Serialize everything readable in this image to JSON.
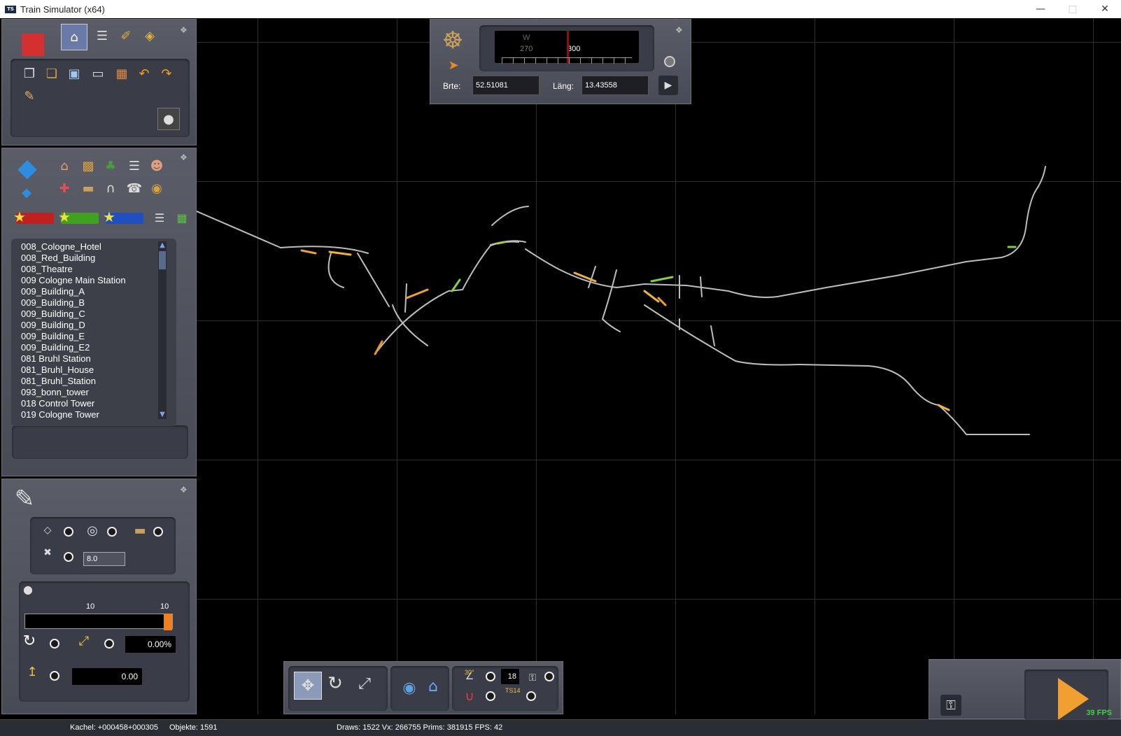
{
  "window": {
    "title": "Train Simulator (x64)",
    "badge": "TS"
  },
  "compass": {
    "dir_letter": "W",
    "tick_left": "270",
    "tick_center": "300",
    "lat_label": "Brte:",
    "lat_value": "52.51081",
    "lon_label": "Läng:",
    "lon_value": "13.43558"
  },
  "objects": {
    "items": [
      "008_Cologne_Hotel",
      "008_Red_Building",
      "008_Theatre",
      "009 Cologne Main Station",
      "009_Building_A",
      "009_Building_B",
      "009_Building_C",
      "009_Building_D",
      "009_Building_E",
      "009_Building_E2",
      "081 Bruhl Station",
      "081_Bruhl_House",
      "081_Bruhl_Station",
      "093_bonn_tower",
      "018 Control Tower",
      "019 Cologne Tower"
    ]
  },
  "properties": {
    "spacing_value": "8.0",
    "slider_left_label": "10",
    "slider_right_label": "10",
    "slider_fraction": 1.0,
    "rotation_value": "0.00%",
    "height_value": "0.00"
  },
  "bottom_toolbar": {
    "angle_label": "30°",
    "snap_value": "18",
    "ts_label": "TS14"
  },
  "fps_badge": "39 FPS",
  "status": {
    "tile": "Kachel: +000458+000305",
    "objects": "Objekte: 1591",
    "stats": "Draws: 1522 Vx: 266755 Prims: 381915 FPS: 42"
  }
}
